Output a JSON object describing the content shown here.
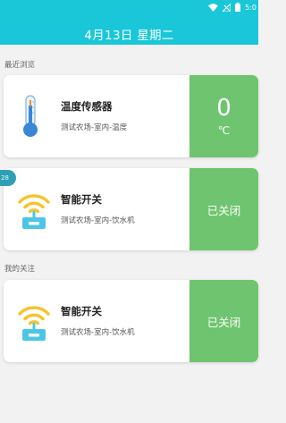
{
  "status_bar": {
    "time": "5:0"
  },
  "header": {
    "title": "4月13日 星期二"
  },
  "sections": {
    "recent": "最近浏览",
    "favorites": "我的关注"
  },
  "cards": [
    {
      "name": "温度传感器",
      "location": "测试农场-室内-温度",
      "value": "0",
      "unit": "℃",
      "icon": "thermometer-icon"
    },
    {
      "name": "智能开关",
      "location": "测试农场-室内-饮水机",
      "status": "已关闭",
      "icon": "wifi-switch-icon"
    },
    {
      "name": "智能开关",
      "location": "测试农场-室内-饮水机",
      "status": "已关闭",
      "icon": "wifi-switch-icon"
    }
  ],
  "side_badge": "28",
  "colors": {
    "header": "#19c7d9",
    "panel": "#6fc46f",
    "icon_wifi": "#f7c32b",
    "icon_box": "#4cc6e6"
  }
}
